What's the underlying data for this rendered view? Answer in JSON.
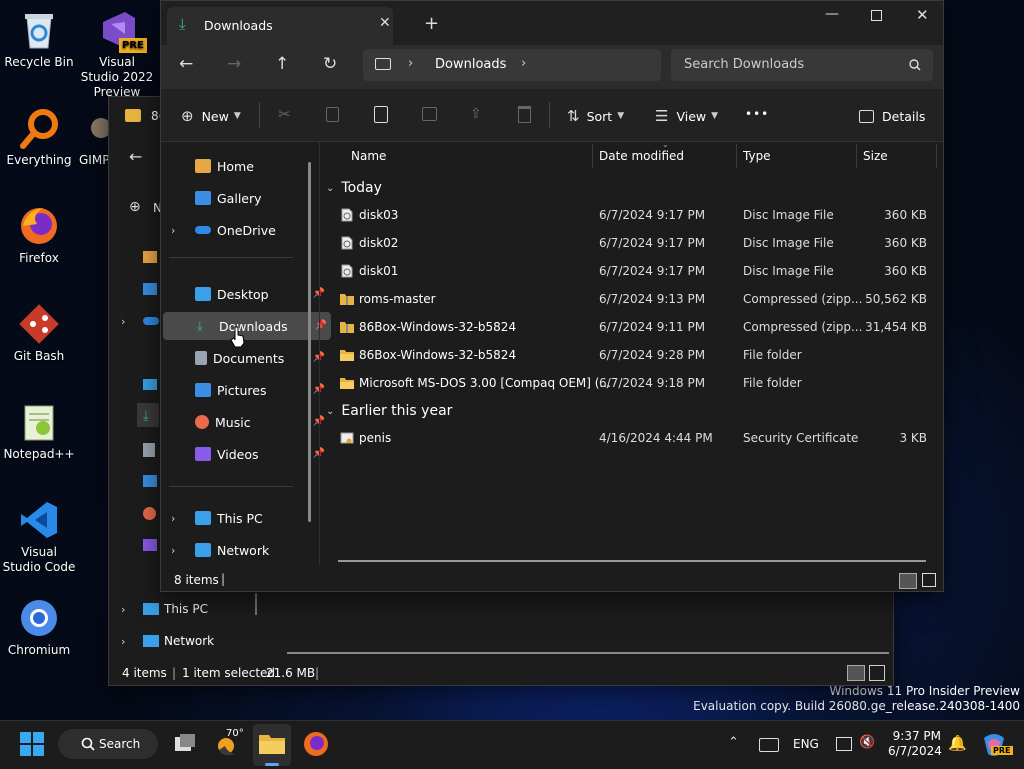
{
  "desktop": {
    "icons": [
      {
        "label": "Recycle Bin"
      },
      {
        "label": "Visual Studio 2022 Preview",
        "badge": "PRE"
      },
      {
        "label": "Everything"
      },
      {
        "label": "GIMP"
      },
      {
        "label": "Firefox"
      },
      {
        "label": "Git Bash"
      },
      {
        "label": "Notepad++"
      },
      {
        "label": "Visual Studio Code"
      },
      {
        "label": "Chromium"
      }
    ],
    "watermark": {
      "line1": "Windows 11 Pro Insider Preview",
      "line2": "Evaluation copy. Build 26080.ge_release.240308-1400"
    }
  },
  "back_window": {
    "tab_fragment": "8(",
    "new_fragment": "N",
    "sidebar": [
      {
        "label": "This PC"
      },
      {
        "label": "Network"
      }
    ],
    "status": {
      "items": "4 items",
      "selected": "1 item selected",
      "size": "21.6 MB"
    }
  },
  "window": {
    "tab_title": "Downloads",
    "address": {
      "crumb": "Downloads"
    },
    "search": {
      "placeholder": "Search Downloads"
    },
    "toolbar": {
      "new": "New",
      "sort": "Sort",
      "view": "View",
      "more": "•••",
      "details": "Details"
    },
    "sidebar": [
      {
        "label": "Home",
        "color": "#e8a646"
      },
      {
        "label": "Gallery",
        "color": "#3a8ee6"
      },
      {
        "label": "OneDrive",
        "color": "#2d8ae8"
      },
      {
        "label": "Desktop",
        "color": "#3aa0e8"
      },
      {
        "label": "Downloads",
        "color": "#3ab87a"
      },
      {
        "label": "Documents",
        "color": "#9aa4b0"
      },
      {
        "label": "Pictures",
        "color": "#3a8ee6"
      },
      {
        "label": "Music",
        "color": "#e86a4a"
      },
      {
        "label": "Videos",
        "color": "#8a5ae8"
      },
      {
        "label": "This PC",
        "color": "#3aa0e8"
      },
      {
        "label": "Network",
        "color": "#3aa0e8"
      }
    ],
    "columns": [
      "Name",
      "Date modified",
      "Type",
      "Size"
    ],
    "groups": {
      "today": "Today",
      "earlier": "Earlier this year"
    },
    "files_today": [
      {
        "name": "disk03",
        "date": "6/7/2024 9:17 PM",
        "type": "Disc Image File",
        "size": "360 KB",
        "icon": "disc"
      },
      {
        "name": "disk02",
        "date": "6/7/2024 9:17 PM",
        "type": "Disc Image File",
        "size": "360 KB",
        "icon": "disc"
      },
      {
        "name": "disk01",
        "date": "6/7/2024 9:17 PM",
        "type": "Disc Image File",
        "size": "360 KB",
        "icon": "disc"
      },
      {
        "name": "roms-master",
        "date": "6/7/2024 9:13 PM",
        "type": "Compressed (zipp...",
        "size": "50,562 KB",
        "icon": "zip"
      },
      {
        "name": "86Box-Windows-32-b5824",
        "date": "6/7/2024 9:11 PM",
        "type": "Compressed (zipp...",
        "size": "31,454 KB",
        "icon": "zip"
      },
      {
        "name": "86Box-Windows-32-b5824",
        "date": "6/7/2024 9:28 PM",
        "type": "File folder",
        "size": "",
        "icon": "folder"
      },
      {
        "name": "Microsoft MS-DOS 3.00 [Compaq OEM] (...",
        "date": "6/7/2024 9:18 PM",
        "type": "File folder",
        "size": "",
        "icon": "folder"
      }
    ],
    "files_earlier": [
      {
        "name": "penis",
        "date": "4/16/2024 4:44 PM",
        "type": "Security Certificate",
        "size": "3 KB",
        "icon": "cert"
      }
    ],
    "status": {
      "items": "8 items"
    }
  },
  "taskbar": {
    "search": "Search",
    "weather": "70°",
    "lang": "ENG",
    "time": "9:37 PM",
    "date": "6/7/2024",
    "copilot_badge": "PRE"
  }
}
